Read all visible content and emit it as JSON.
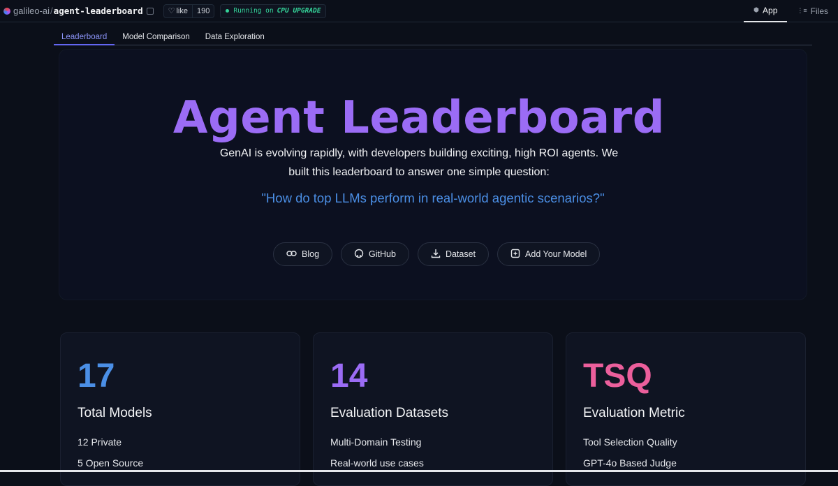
{
  "repo": {
    "org": "galileo-ai",
    "name": "agent-leaderboard"
  },
  "like": {
    "label": "like",
    "count": "190"
  },
  "status": {
    "text": "Running on",
    "hardware": "CPU UPGRADE"
  },
  "topnav": {
    "app": "App",
    "files": "Files"
  },
  "tabs": [
    "Leaderboard",
    "Model Comparison",
    "Data Exploration"
  ],
  "hero": {
    "title": "Agent Leaderboard",
    "subtitle": "GenAI is evolving rapidly, with developers building exciting, high ROI agents. We built this leaderboard to answer one simple question:",
    "quote": "\"How do top LLMs perform in real-world agentic scenarios?\"",
    "buttons": [
      {
        "label": "Blog",
        "icon": "link-icon"
      },
      {
        "label": "GitHub",
        "icon": "github-icon"
      },
      {
        "label": "Dataset",
        "icon": "download-icon"
      },
      {
        "label": "Add Your Model",
        "icon": "plus-box-icon"
      }
    ]
  },
  "cards": [
    {
      "value": "17",
      "title": "Total Models",
      "line1": "12 Private",
      "line2": "5 Open Source",
      "color": "#4b8fe6"
    },
    {
      "value": "14",
      "title": "Evaluation Datasets",
      "line1": "Multi-Domain Testing",
      "line2": "Real-world use cases",
      "color": "#9b6cf5"
    },
    {
      "value": "TSQ",
      "title": "Evaluation Metric",
      "line1": "Tool Selection Quality",
      "line2": "GPT-4o Based Judge",
      "color": "#ec5f9c"
    }
  ],
  "colors": {
    "accent": "#9b6cf5",
    "quote": "#4b8fe6",
    "running": "#34d399"
  }
}
